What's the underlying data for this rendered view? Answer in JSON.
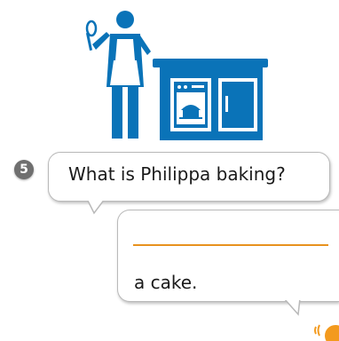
{
  "exercise": {
    "number": "5",
    "question": "What is Philippa baking?",
    "answer_suffix": "a cake."
  },
  "colors": {
    "illustration": "#0a73b8",
    "answer_line": "#e8921e",
    "audio": "#f39a1e",
    "badge": "#6f6f6f"
  },
  "icons": {
    "illustration": "baker-with-oven-icon",
    "audio": "speaker-icon"
  }
}
